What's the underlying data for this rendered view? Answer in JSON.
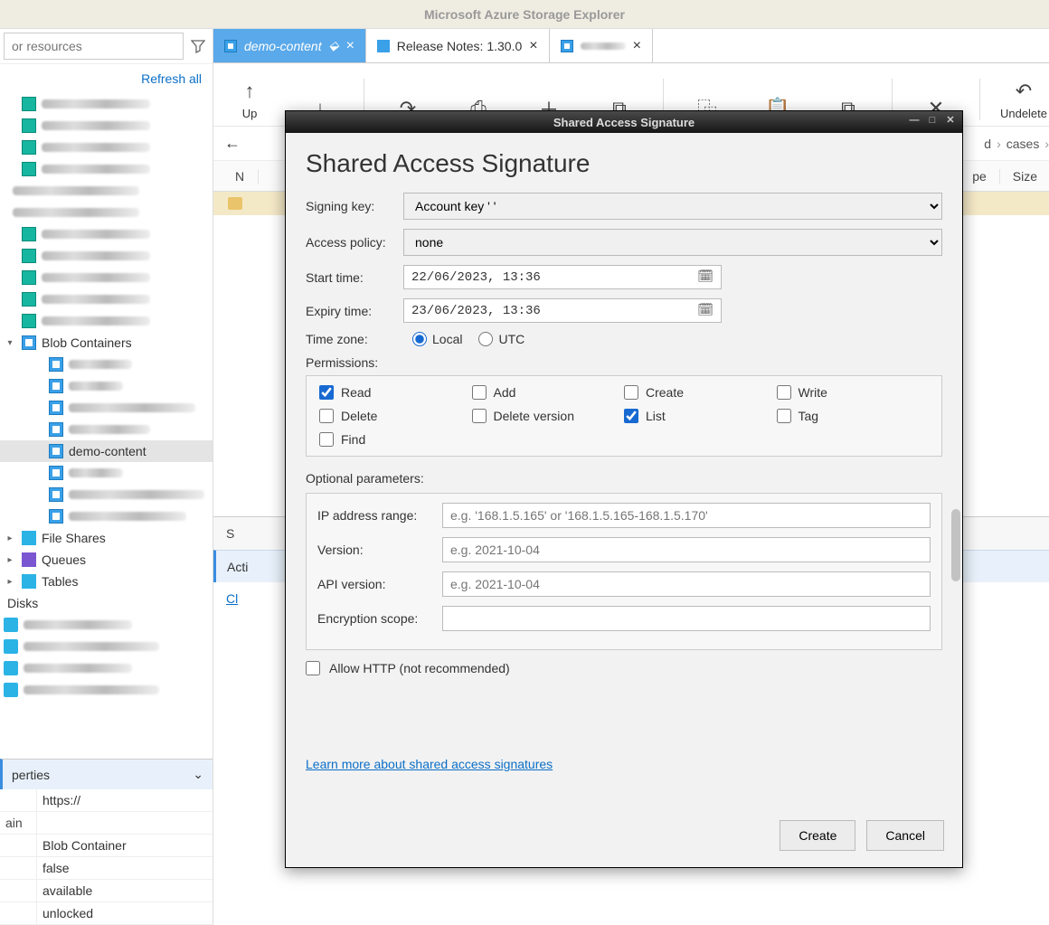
{
  "app": {
    "title": "Microsoft Azure Storage Explorer"
  },
  "sidebar": {
    "search_placeholder": "or resources",
    "refresh": "Refresh all",
    "tree": {
      "blob_containers": "Blob Containers",
      "selected_container": "demo-content",
      "file_shares": "File Shares",
      "queues": "Queues",
      "tables": "Tables",
      "disks": "Disks"
    },
    "properties": {
      "header": "perties",
      "rows": [
        {
          "label": "",
          "value": "https://"
        },
        {
          "label": "ain",
          "value": ""
        },
        {
          "label": "",
          "value": "Blob Container"
        },
        {
          "label": "",
          "value": "false"
        },
        {
          "label": "",
          "value": "available"
        },
        {
          "label": "",
          "value": "unlocked"
        }
      ]
    }
  },
  "tabs": [
    {
      "label": "demo-content",
      "active": true
    },
    {
      "label": "Release Notes: 1.30.0",
      "active": false
    },
    {
      "label": "",
      "active": false
    }
  ],
  "toolbar": {
    "upload": "Up",
    "download": "",
    "open": "",
    "preview": "",
    "new": "",
    "copy": "",
    "copy2": "",
    "paste": "",
    "clone": "",
    "delete": "",
    "undelete": "Undelete"
  },
  "breadcrumb": {
    "right1": "d",
    "right2": "cases"
  },
  "columns": {
    "name": "N",
    "pe": "pe",
    "size": "Size"
  },
  "status": {
    "summary": "S"
  },
  "activities": {
    "header": "Acti",
    "clear": "Cl"
  },
  "dialog": {
    "window_title": "Shared Access Signature",
    "heading": "Shared Access Signature",
    "signing_key_label": "Signing key:",
    "signing_key_value": "Account key '         '",
    "access_policy_label": "Access policy:",
    "access_policy_value": "none",
    "start_time_label": "Start time:",
    "start_time_value": "22/06/2023, 13:36",
    "expiry_time_label": "Expiry time:",
    "expiry_time_value": "23/06/2023, 13:36",
    "timezone_label": "Time zone:",
    "tz_local": "Local",
    "tz_utc": "UTC",
    "permissions_label": "Permissions:",
    "perms": {
      "read": "Read",
      "add": "Add",
      "create": "Create",
      "write": "Write",
      "delete": "Delete",
      "delete_version": "Delete version",
      "list": "List",
      "tag": "Tag",
      "find": "Find"
    },
    "optional_label": "Optional parameters:",
    "ip_label": "IP address range:",
    "ip_placeholder": "e.g. '168.1.5.165' or '168.1.5.165-168.1.5.170'",
    "version_label": "Version:",
    "version_placeholder": "e.g. 2021-10-04",
    "api_version_label": "API version:",
    "api_version_placeholder": "e.g. 2021-10-04",
    "encryption_label": "Encryption scope:",
    "allow_http": "Allow HTTP (not recommended)",
    "learn_more": "Learn more about shared access signatures",
    "create_btn": "Create",
    "cancel_btn": "Cancel"
  }
}
